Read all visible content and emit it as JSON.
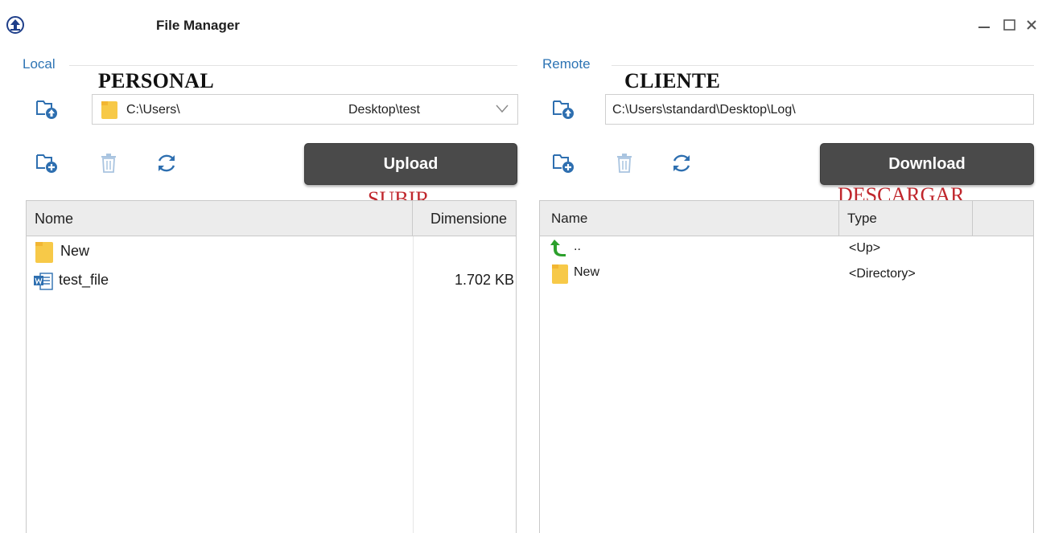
{
  "window": {
    "title": "File Manager",
    "controls": {
      "minimize": "minimize-icon",
      "maximize": "maximize-icon",
      "close": "close-icon"
    }
  },
  "local": {
    "group_label": "Local",
    "annotation": "PERSONAL",
    "path_prefix": "C:\\Users\\",
    "path_suffix": "Desktop\\test",
    "upload_label": "Upload",
    "upload_annotation": "SUBIR",
    "columns": [
      "Nome",
      "Dimensione"
    ],
    "rows": [
      {
        "name": "New",
        "size": "",
        "icon": "folder-icon"
      },
      {
        "name": "test_file",
        "size": "1.702 KB",
        "icon": "word-doc-icon"
      }
    ]
  },
  "remote": {
    "group_label": "Remote",
    "annotation": "CLIENTE",
    "path": "C:\\Users\\standard\\Desktop\\Log\\",
    "download_label": "Download",
    "download_annotation": "DESCARGAR",
    "columns": [
      "Name",
      "Type"
    ],
    "rows": [
      {
        "name": "..",
        "type": "<Up>",
        "icon": "up-arrow-icon"
      },
      {
        "name": "New",
        "type": "<Directory>",
        "icon": "folder-icon"
      }
    ]
  },
  "colors": {
    "accent": "#2d74b4",
    "button_bg": "#4a4a4a",
    "annotation_red": "#c0272d",
    "folder_yellow": "#f7c948",
    "icon_blue": "#2e6fb0"
  }
}
